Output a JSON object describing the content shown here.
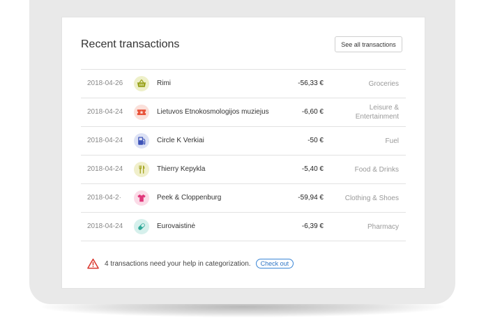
{
  "card": {
    "title": "Recent transactions",
    "see_all_label": "See all transactions"
  },
  "transactions": [
    {
      "date": "2018-04-26",
      "merchant": "Rimi",
      "amount": "-56,33 €",
      "category": "Groceries",
      "icon": "shopping-basket-icon",
      "icon_color": "#9aa31f",
      "icon_bg": "#eef0c9"
    },
    {
      "date": "2018-04-24",
      "merchant": "Lietuvos Etnokosmologijos muziejus",
      "amount": "-6,60 €",
      "category": "Leisure &\nEntertainment",
      "icon": "ticket-icon",
      "icon_color": "#e8533a",
      "icon_bg": "#fbe0da"
    },
    {
      "date": "2018-04-24",
      "merchant": "Circle K Verkiai",
      "amount": "-50 €",
      "category": "Fuel",
      "icon": "fuel-pump-icon",
      "icon_color": "#3d53b8",
      "icon_bg": "#dde2f5"
    },
    {
      "date": "2018-04-24",
      "merchant": "Thierry Kepykla",
      "amount": "-5,40 €",
      "category": "Food & Drinks",
      "icon": "cutlery-icon",
      "icon_color": "#a5a520",
      "icon_bg": "#f0efcb"
    },
    {
      "date": "2018-04-2·",
      "merchant": "Peek & Cloppenburg",
      "amount": "-59,94 €",
      "category": "Clothing & Shoes",
      "icon": "tshirt-icon",
      "icon_color": "#e0367a",
      "icon_bg": "#fbdbe7"
    },
    {
      "date": "2018-04-24",
      "merchant": "Eurovaistinė",
      "amount": "-6,39 €",
      "category": "Pharmacy",
      "icon": "pill-icon",
      "icon_color": "#2ea898",
      "icon_bg": "#d6f0ec"
    }
  ],
  "notice": {
    "text": "4 transactions need your help in categorization.",
    "button_label": "Check out",
    "icon": "warning-icon",
    "icon_color": "#d9352c",
    "button_color": "#3a86d6"
  }
}
